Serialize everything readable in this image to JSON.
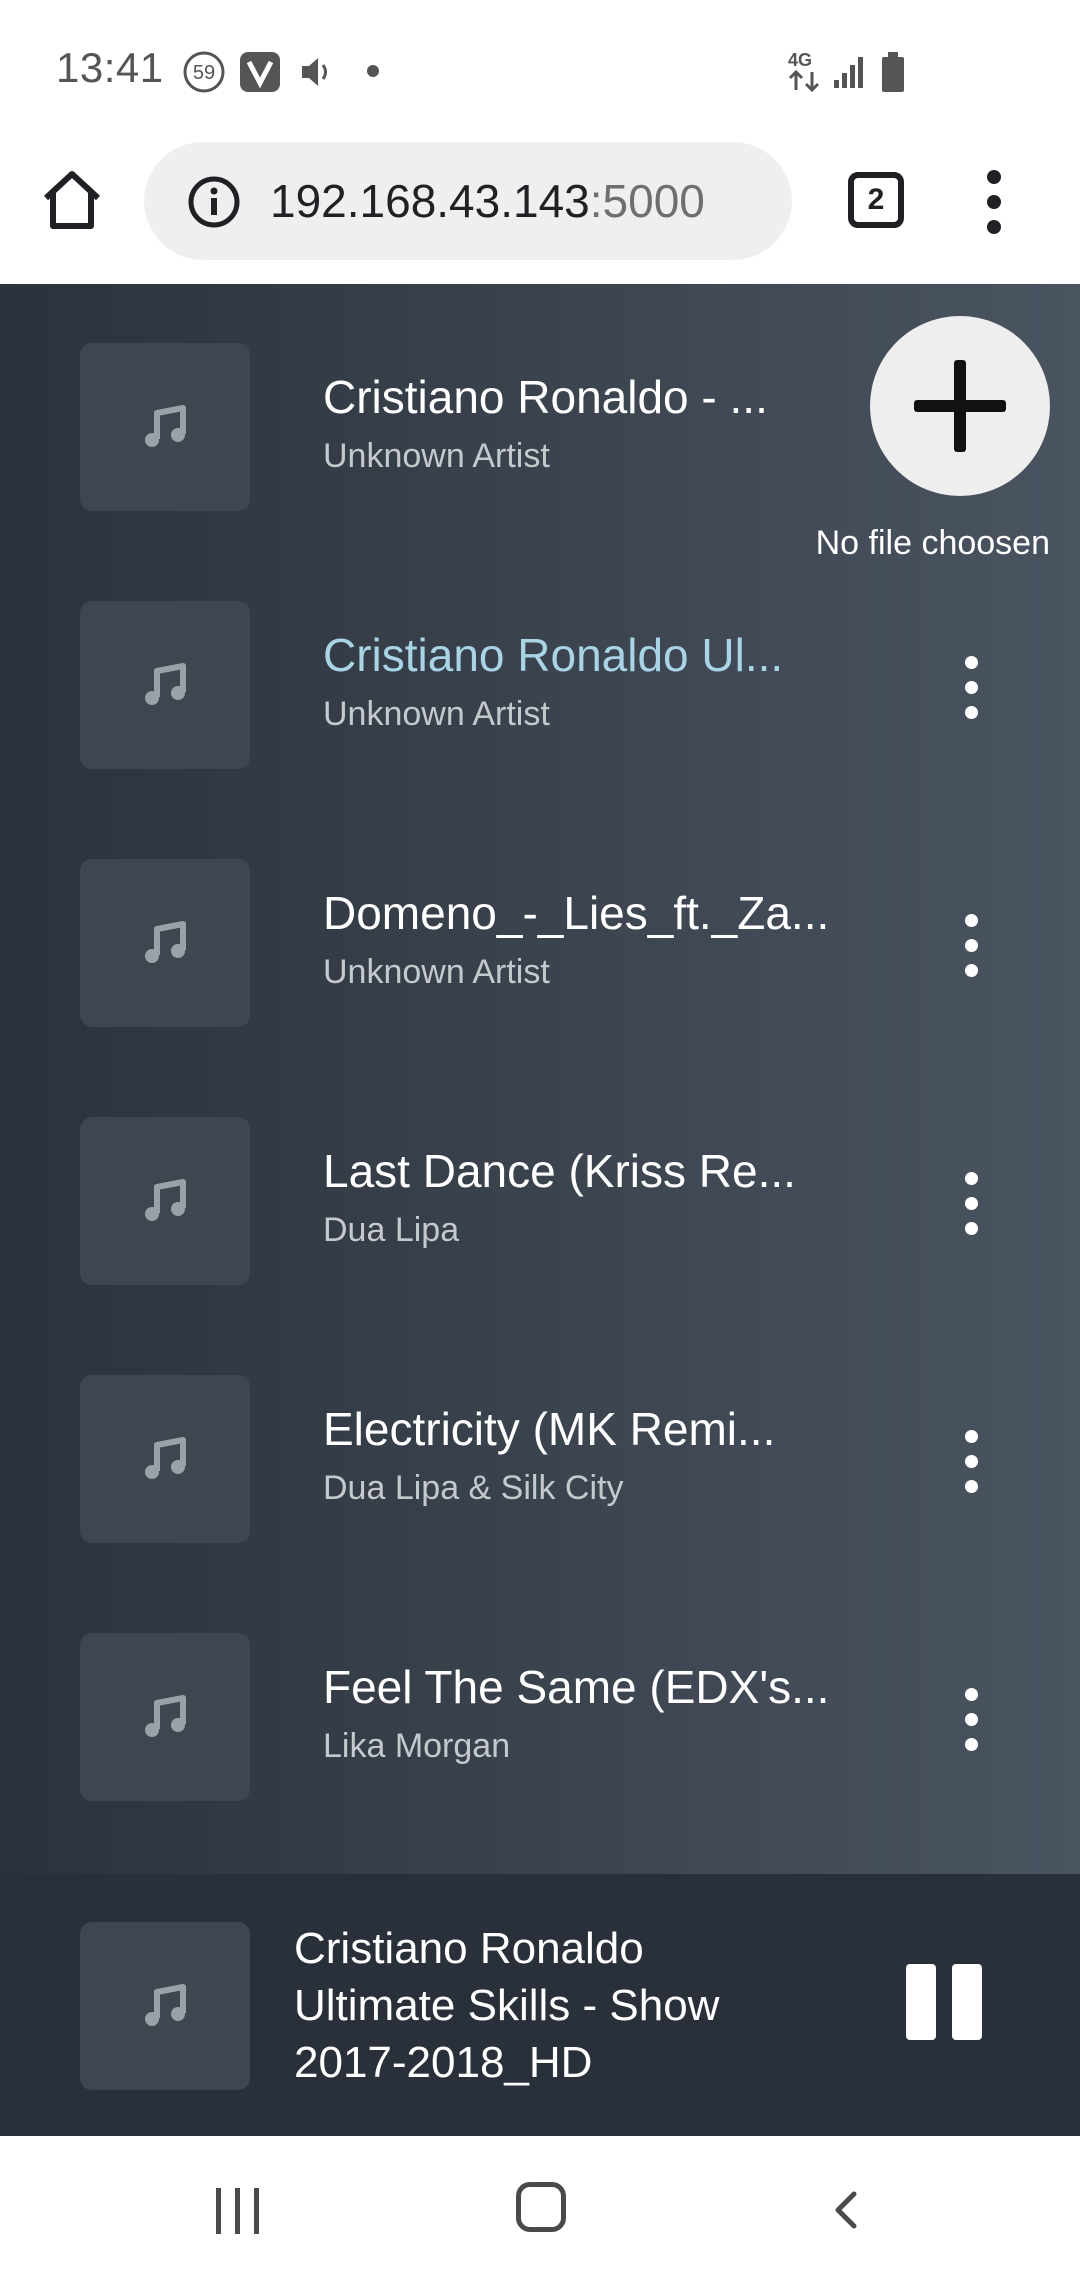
{
  "status_bar": {
    "time": "13:41",
    "badge": "59",
    "network": "4G",
    "icons": [
      "notification-count-icon",
      "v-app-icon",
      "volume-icon",
      "dot-icon",
      "4g-data-icon",
      "signal-icon",
      "battery-icon"
    ]
  },
  "browser": {
    "url_host": "192.168.43.143",
    "url_port": ":5000",
    "tab_count": "2"
  },
  "upload": {
    "status": "No file choosen"
  },
  "tracks": [
    {
      "title": "Cristiano Ronaldo - ...",
      "artist": "Unknown Artist",
      "active": false
    },
    {
      "title": "Cristiano Ronaldo Ul...",
      "artist": "Unknown Artist",
      "active": true
    },
    {
      "title": "Domeno_-_Lies_ft._Za...",
      "artist": "Unknown Artist",
      "active": false
    },
    {
      "title": "Last Dance (Kriss Re...",
      "artist": "Dua Lipa",
      "active": false
    },
    {
      "title": "Electricity (MK Remi...",
      "artist": "Dua Lipa & Silk City",
      "active": false
    },
    {
      "title": "Feel The Same (EDX's...",
      "artist": "Lika Morgan",
      "active": false
    }
  ],
  "now_playing": {
    "title": "Cristiano Ronaldo Ultimate Skills - Show 2017-2018_HD"
  },
  "colors": {
    "active_title": "#a8d4e6",
    "player_bg": "#29303a"
  }
}
